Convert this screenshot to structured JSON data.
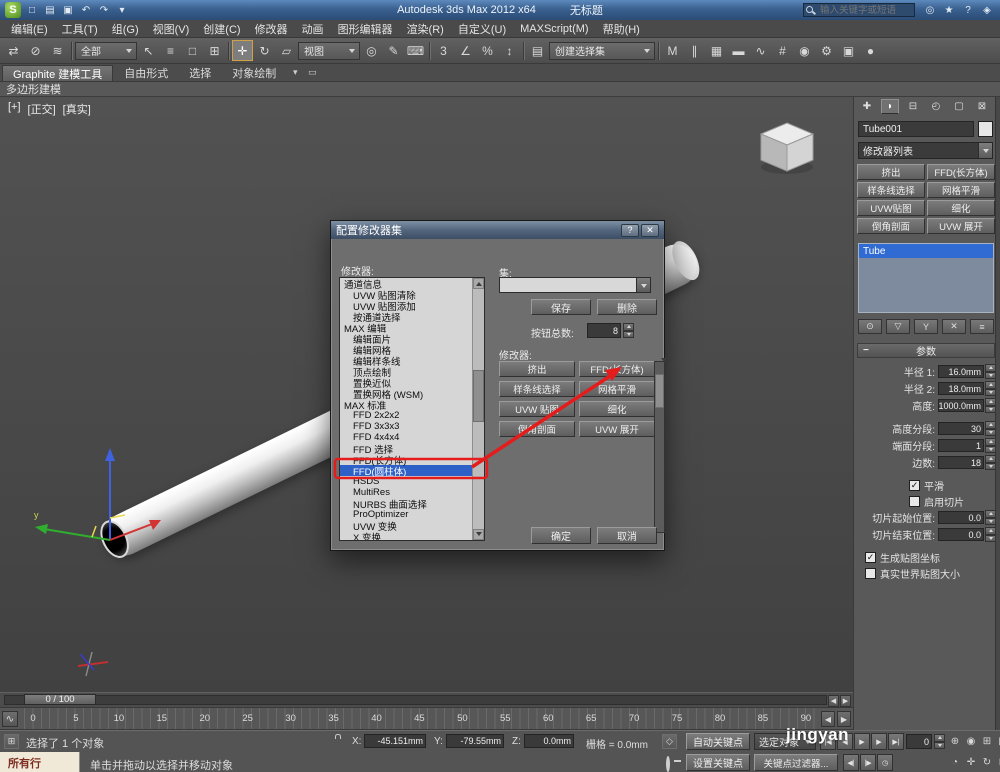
{
  "window": {
    "title_app": "Autodesk 3ds Max 2012 x64",
    "title_doc": "无标题",
    "search_placeholder": "输入关键字或短语",
    "logo_letter": "S",
    "quick_icons": [
      {
        "name": "new-scene-icon",
        "glyph": "□"
      },
      {
        "name": "open-file-icon",
        "glyph": "▤"
      },
      {
        "name": "save-file-icon",
        "glyph": "▣"
      },
      {
        "name": "undo-icon",
        "glyph": "↶"
      },
      {
        "name": "redo-icon",
        "glyph": "↷"
      },
      {
        "name": "quick-access-dropdown-icon",
        "glyph": "▾"
      }
    ],
    "right_icons": [
      {
        "name": "communication-center-icon",
        "glyph": "◎"
      },
      {
        "name": "favorites-icon",
        "glyph": "★"
      },
      {
        "name": "help-icon",
        "glyph": "?"
      },
      {
        "name": "infocenter-icon",
        "glyph": "◈"
      }
    ]
  },
  "menus": [
    "编辑(E)",
    "工具(T)",
    "组(G)",
    "视图(V)",
    "创建(C)",
    "修改器",
    "动画",
    "图形编辑器",
    "渲染(R)",
    "自定义(U)",
    "MAXScript(M)",
    "帮助(H)"
  ],
  "toolbar": {
    "items": [
      {
        "type": "icon",
        "name": "select-and-link-icon",
        "glyph": "⇄"
      },
      {
        "type": "icon",
        "name": "unlink-selection-icon",
        "glyph": "⊘"
      },
      {
        "type": "icon",
        "name": "bind-to-space-warp-icon",
        "glyph": "≋"
      },
      {
        "type": "sep"
      },
      {
        "type": "dropdown",
        "name": "selection-filter-dropdown",
        "label": "全部"
      },
      {
        "type": "icon",
        "name": "select-object-icon",
        "glyph": "↖"
      },
      {
        "type": "icon",
        "name": "select-by-name-icon",
        "glyph": "≡"
      },
      {
        "type": "icon",
        "name": "selection-region-icon",
        "glyph": "□"
      },
      {
        "type": "icon",
        "name": "window-crossing-icon",
        "glyph": "⊞"
      },
      {
        "type": "sep"
      },
      {
        "type": "icon",
        "name": "select-and-move-icon",
        "glyph": "✛",
        "active": true
      },
      {
        "type": "icon",
        "name": "select-and-rotate-icon",
        "glyph": "↻"
      },
      {
        "type": "icon",
        "name": "select-and-scale-icon",
        "glyph": "▱"
      },
      {
        "type": "dropdown",
        "name": "reference-coordinate-dropdown",
        "label": "视图"
      },
      {
        "type": "icon",
        "name": "use-pivot-center-icon",
        "glyph": "◎"
      },
      {
        "type": "icon",
        "name": "select-and-manipulate-icon",
        "glyph": "✎"
      },
      {
        "type": "icon",
        "name": "keyboard-override-icon",
        "glyph": "⌨"
      },
      {
        "type": "sep"
      },
      {
        "type": "icon",
        "name": "snap-toggle-3d-icon",
        "glyph": "3"
      },
      {
        "type": "icon",
        "name": "angle-snap-icon",
        "glyph": "∠"
      },
      {
        "type": "icon",
        "name": "percent-snap-icon",
        "glyph": "%"
      },
      {
        "type": "icon",
        "name": "spinner-snap-icon",
        "glyph": "↕"
      },
      {
        "type": "sep"
      },
      {
        "type": "icon",
        "name": "edit-named-sets-icon",
        "glyph": "▤"
      },
      {
        "type": "dropdown",
        "name": "named-selection-sets-dropdown",
        "label": "创建选择集",
        "wide": true
      },
      {
        "type": "sep"
      },
      {
        "type": "icon",
        "name": "mirror-icon",
        "glyph": "M"
      },
      {
        "type": "icon",
        "name": "align-icon",
        "glyph": "∥"
      },
      {
        "type": "icon",
        "name": "layer-manager-icon",
        "glyph": "▦"
      },
      {
        "type": "icon",
        "name": "graphite-toggle-icon",
        "glyph": "▬"
      },
      {
        "type": "icon",
        "name": "curve-editor-icon",
        "glyph": "∿"
      },
      {
        "type": "icon",
        "name": "schematic-view-icon",
        "glyph": "#"
      },
      {
        "type": "icon",
        "name": "material-editor-icon",
        "glyph": "◉"
      },
      {
        "type": "icon",
        "name": "render-setup-icon",
        "glyph": "⚙"
      },
      {
        "type": "icon",
        "name": "rendered-frame-icon",
        "glyph": "▣"
      },
      {
        "type": "icon",
        "name": "render-production-icon",
        "glyph": "●"
      }
    ]
  },
  "ribbon": {
    "tabs": [
      "Graphite 建模工具",
      "自由形式",
      "选择",
      "对象绘制"
    ],
    "extras": [
      {
        "name": "ribbon-minimize-icon",
        "glyph": "▾"
      },
      {
        "name": "ribbon-panel-icon",
        "glyph": "▭"
      }
    ],
    "subtab": "多边形建模"
  },
  "viewport": {
    "labels": [
      "[+]",
      "[正交]",
      "[真实]"
    ]
  },
  "dialog": {
    "title": "配置修改器集",
    "help_glyph": "?",
    "close_glyph": "✕",
    "modifiers_label": "修改器:",
    "sets_label": "集:",
    "save": "保存",
    "delete": "删除",
    "total_label": "按钮总数:",
    "total_value": "8",
    "grid_label": "修改器:",
    "ok": "确定",
    "cancel": "取消",
    "list": [
      {
        "text": "通道信息",
        "ind": 0
      },
      {
        "text": "UVW 贴图清除",
        "ind": 1
      },
      {
        "text": "UVW 贴图添加",
        "ind": 1
      },
      {
        "text": "按通道选择",
        "ind": 1
      },
      {
        "text": "MAX 编辑",
        "ind": 0
      },
      {
        "text": "编辑面片",
        "ind": 1
      },
      {
        "text": "编辑网格",
        "ind": 1
      },
      {
        "text": "编辑样条线",
        "ind": 1
      },
      {
        "text": "顶点绘制",
        "ind": 1
      },
      {
        "text": "置换近似",
        "ind": 1
      },
      {
        "text": "置换网格 (WSM)",
        "ind": 1
      },
      {
        "text": "MAX 标准",
        "ind": 0
      },
      {
        "text": "FFD 2x2x2",
        "ind": 1
      },
      {
        "text": "FFD 3x3x3",
        "ind": 1
      },
      {
        "text": "FFD 4x4x4",
        "ind": 1
      },
      {
        "text": "FFD 选择",
        "ind": 1
      },
      {
        "text": "FFD(长方体)",
        "ind": 1
      },
      {
        "text": "FFD(圆柱体)",
        "ind": 1,
        "selected": true
      },
      {
        "text": "HSDS",
        "ind": 1
      },
      {
        "text": "MultiRes",
        "ind": 1
      },
      {
        "text": "NURBS 曲面选择",
        "ind": 1
      },
      {
        "text": "ProOptimizer",
        "ind": 1
      },
      {
        "text": "UVW 变换",
        "ind": 1
      },
      {
        "text": "X 变换",
        "ind": 1
      }
    ],
    "grid": [
      "挤出",
      "FFD(长方体)",
      "样条线选择",
      "网格平滑",
      "UVW 贴图",
      "细化",
      "倒角剖面",
      "UVW 展开"
    ]
  },
  "panel": {
    "tabs": [
      {
        "name": "create-tab-icon",
        "glyph": "✚"
      },
      {
        "name": "modify-tab-icon",
        "glyph": "◗",
        "active": true
      },
      {
        "name": "hierarchy-tab-icon",
        "glyph": "⊟"
      },
      {
        "name": "motion-tab-icon",
        "glyph": "◴"
      },
      {
        "name": "display-tab-icon",
        "glyph": "▢"
      },
      {
        "name": "utilities-tab-icon",
        "glyph": "⊠"
      }
    ],
    "object_name": "Tube001",
    "modifier_list_label": "修改器列表",
    "buttons": [
      "挤出",
      "FFD(长方体)",
      "样条线选择",
      "网格平滑",
      "UVW贴图",
      "细化",
      "倒角剖面",
      "UVW 展开"
    ],
    "stack": [
      "Tube"
    ],
    "stack_tools": [
      {
        "name": "pin-stack-icon",
        "glyph": "⊙"
      },
      {
        "name": "show-end-result-icon",
        "glyph": "▽"
      },
      {
        "name": "make-unique-icon",
        "glyph": "Y"
      },
      {
        "name": "remove-modifier-icon",
        "glyph": "✕"
      },
      {
        "name": "configure-modifier-sets-icon",
        "glyph": "≡"
      }
    ],
    "params_title": "参数",
    "param_rows": [
      {
        "type": "num",
        "label": "半径 1:",
        "value": "16.0mm"
      },
      {
        "type": "num",
        "label": "半径 2:",
        "value": "18.0mm"
      },
      {
        "type": "num",
        "label": "高度:",
        "value": "1000.0mm"
      },
      {
        "type": "gap"
      },
      {
        "type": "num",
        "label": "高度分段:",
        "value": "30"
      },
      {
        "type": "num",
        "label": "端面分段:",
        "value": "1"
      },
      {
        "type": "num",
        "label": "边数:",
        "value": "18"
      },
      {
        "type": "gap"
      },
      {
        "type": "check",
        "label": "平滑",
        "checked": true,
        "ind": 1
      },
      {
        "type": "check",
        "label": "启用切片",
        "checked": false,
        "ind": 1
      },
      {
        "type": "num",
        "label": "切片起始位置:",
        "value": "0.0"
      },
      {
        "type": "num",
        "label": "切片结束位置:",
        "value": "0.0"
      },
      {
        "type": "gap"
      },
      {
        "type": "check",
        "label": "生成贴图坐标",
        "checked": true,
        "ind": 0
      },
      {
        "type": "check",
        "label": "真实世界贴图大小",
        "checked": false,
        "ind": 0
      }
    ]
  },
  "timeline": {
    "slider": "0 / 100",
    "ticks": [
      "0",
      "5",
      "10",
      "15",
      "20",
      "25",
      "30",
      "35",
      "40",
      "45",
      "50",
      "55",
      "60",
      "65",
      "70",
      "75",
      "80",
      "85",
      "90"
    ]
  },
  "status": {
    "selection": "选择了 1 个对象",
    "x_label": "X:",
    "x_value": "-45.151mm",
    "y_label": "Y:",
    "y_value": "-79.55mm",
    "z_label": "Z:",
    "z_value": "0.0mm",
    "grid_text": "栅格 = 0.0mm",
    "autokey": "自动关键点",
    "selected_dropdown": "选定对象",
    "setkey": "设置关键点",
    "keyfilter": "关键点过滤器...",
    "prompt": "单击并拖动以选择并移动对象",
    "mini_listener": "所有行",
    "frame_value": "0",
    "watermark": "jingyan",
    "transport1": [
      {
        "name": "go-to-start-button",
        "glyph": "|◀"
      },
      {
        "name": "previous-frame-button",
        "glyph": "◀"
      },
      {
        "name": "play-button",
        "glyph": "▶"
      },
      {
        "name": "next-frame-button",
        "glyph": "▶"
      },
      {
        "name": "go-to-end-button",
        "glyph": "▶|"
      }
    ],
    "transport2": [
      {
        "name": "key-step-back-button",
        "glyph": "◀|"
      },
      {
        "name": "key-step-forward-button",
        "glyph": "|▶"
      },
      {
        "name": "time-configuration-button",
        "glyph": "◷"
      }
    ],
    "nav1": [
      {
        "name": "zoom-icon",
        "glyph": "⊕"
      },
      {
        "name": "zoom-all-icon",
        "glyph": "◉"
      },
      {
        "name": "zoom-extents-icon",
        "glyph": "⊞"
      },
      {
        "name": "zoom-extents-all-icon",
        "glyph": "▦"
      }
    ],
    "nav2": [
      {
        "name": "field-of-view-icon",
        "glyph": "◔"
      },
      {
        "name": "pan-icon",
        "glyph": "✛"
      },
      {
        "name": "orbit-icon",
        "glyph": "↻"
      },
      {
        "name": "maximize-viewport-icon",
        "glyph": "⊡"
      }
    ]
  }
}
